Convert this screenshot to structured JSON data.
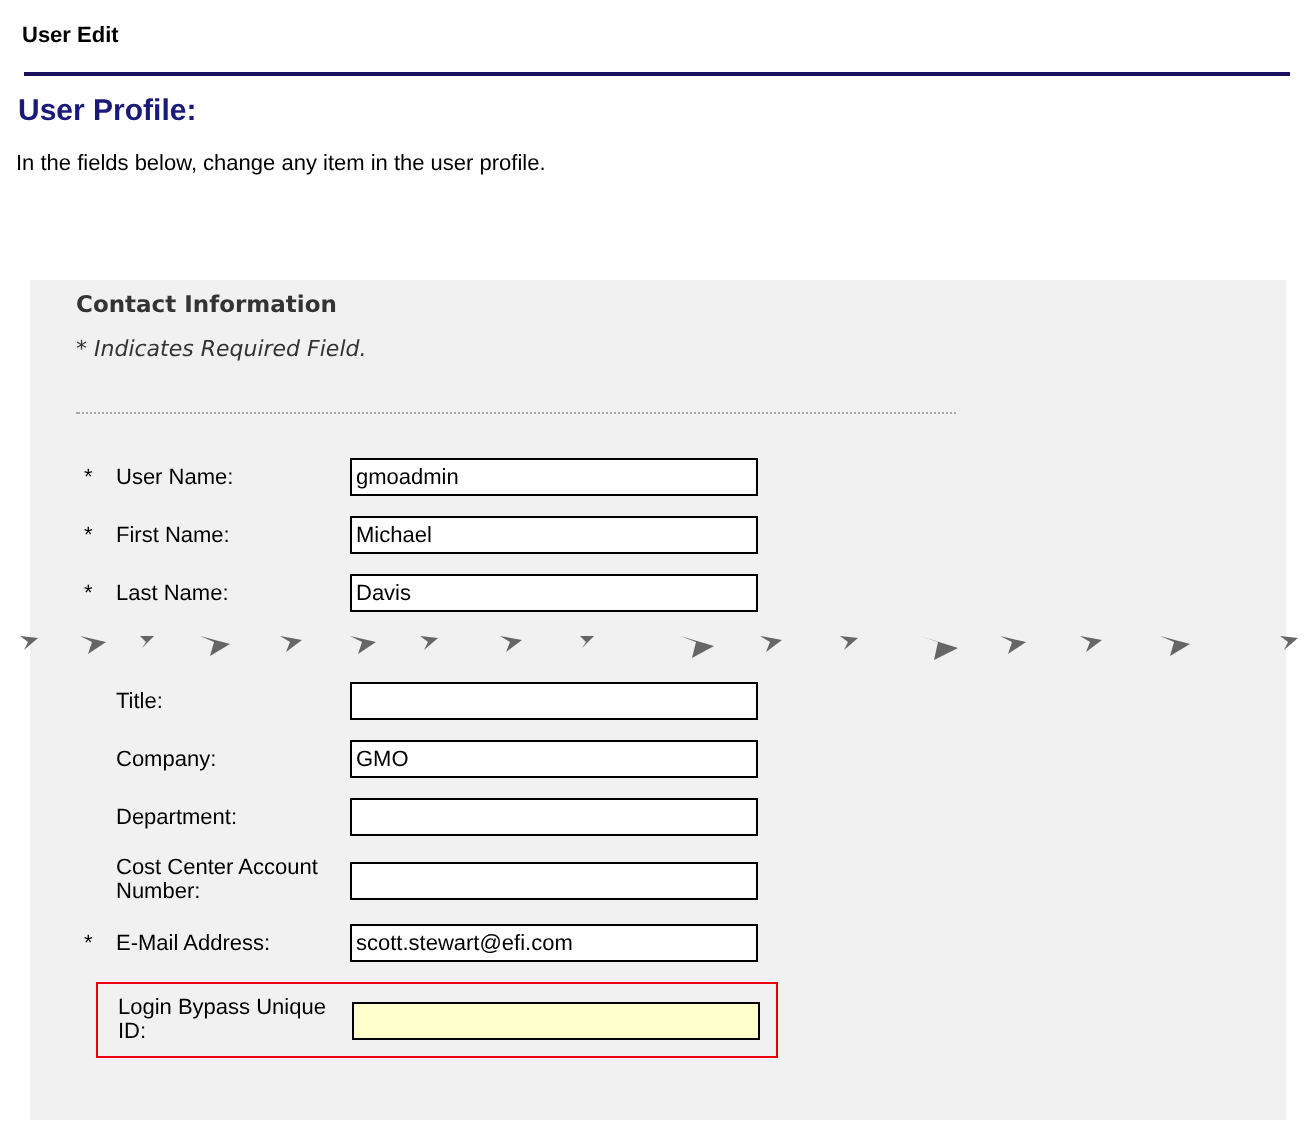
{
  "page_title": "User Edit",
  "heading": "User Profile:",
  "intro": "In the fields below, change any item in the user profile.",
  "panel": {
    "title": "Contact Information",
    "note": "* Indicates Required Field.",
    "required_mark": "*",
    "fields": [
      {
        "label": "User Name:",
        "value": "gmoadmin",
        "required": true,
        "highlighted": false
      },
      {
        "label": "First Name:",
        "value": "Michael",
        "required": true,
        "highlighted": false
      },
      {
        "label": "Last Name:",
        "value": "Davis",
        "required": true,
        "highlighted": false
      },
      {
        "label": "Title:",
        "required": false,
        "highlighted": false
      },
      {
        "label": "Company:",
        "value": "GMO",
        "required": false,
        "highlighted": false
      },
      {
        "label": "Department:",
        "required": false,
        "highlighted": false
      },
      {
        "label": "Cost Center Account Number:",
        "required": false,
        "highlighted": false
      },
      {
        "label": "E-Mail Address:",
        "value": "scott.stewart@efi.com",
        "required": true,
        "highlighted": false
      },
      {
        "label": "Login Bypass Unique ID:",
        "required": false,
        "highlighted": true
      }
    ]
  }
}
